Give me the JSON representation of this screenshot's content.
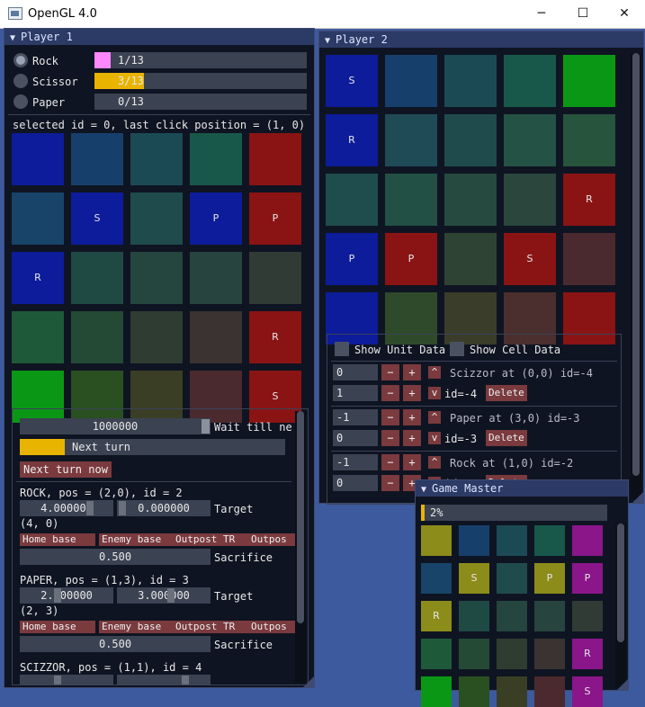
{
  "window": {
    "title": "OpenGL 4.0",
    "minimize": "─",
    "maximize": "☐",
    "close": "✕"
  },
  "player1": {
    "title": "Player 1",
    "counters": [
      {
        "label": "Rock",
        "text": "1/13",
        "fill": 0.077,
        "color": "#ff88ff",
        "selected": true
      },
      {
        "label": "Scissor",
        "text": "3/13",
        "fill": 0.231,
        "color": "#e8b400",
        "selected": false
      },
      {
        "label": "Paper",
        "text": "0/13",
        "fill": 0.0,
        "color": "#e8b400",
        "selected": false
      }
    ],
    "info": "selected id = 0, last click position = (1, 0)",
    "grid": [
      [
        {
          "c": "#0d1c9a",
          "t": ""
        },
        {
          "c": "#173f6b",
          "t": ""
        },
        {
          "c": "#1b4a55",
          "t": ""
        },
        {
          "c": "#18584a",
          "t": ""
        },
        {
          "c": "#8a1414",
          "t": ""
        }
      ],
      [
        {
          "c": "#174468",
          "t": ""
        },
        {
          "c": "#0d1c9a",
          "t": "S"
        },
        {
          "c": "#1f4b4c",
          "t": ""
        },
        {
          "c": "#0d1c9a",
          "t": "P"
        },
        {
          "c": "#8a1414",
          "t": "P"
        }
      ],
      [
        {
          "c": "#0d1c9a",
          "t": "R"
        },
        {
          "c": "#1f4a44",
          "t": ""
        },
        {
          "c": "#25453f",
          "t": ""
        },
        {
          "c": "#27443f",
          "t": ""
        },
        {
          "c": "#2f3b34",
          "t": ""
        }
      ],
      [
        {
          "c": "#1e5a39",
          "t": ""
        },
        {
          "c": "#244a35",
          "t": ""
        },
        {
          "c": "#2f3c31",
          "t": ""
        },
        {
          "c": "#3a3331",
          "t": ""
        },
        {
          "c": "#8a1414",
          "t": "R"
        }
      ],
      [
        {
          "c": "#0b9716",
          "t": ""
        },
        {
          "c": "#2a5022",
          "t": ""
        },
        {
          "c": "#3a3e25",
          "t": ""
        },
        {
          "c": "#4a2a2e",
          "t": ""
        },
        {
          "c": "#8a1414",
          "t": "S"
        }
      ]
    ],
    "sub": {
      "slider_value": "1000000",
      "wait_label": "Wait till ne",
      "next_turn_label": "Next turn",
      "next_turn_progress": 0.17,
      "next_turn_now": "Next turn now",
      "units": [
        {
          "header": "ROCK, pos = (2,0), id = 2",
          "v1": "4.000000",
          "v2": "0.000000",
          "target_label": "Target",
          "coord": "(4, 0)",
          "sacrifice": "0.500",
          "sacrifice_label": "Sacrifice"
        },
        {
          "header": "PAPER, pos = (1,3), id = 3",
          "v1": "2.000000",
          "v2": "3.000000",
          "target_label": "Target",
          "coord": "(2, 3)",
          "sacrifice": "0.500",
          "sacrifice_label": "Sacrifice"
        }
      ],
      "buttons": [
        "Home base",
        "Enemy base",
        "Outpost TR",
        "Outpos"
      ],
      "last_header": "SCIZZOR, pos = (1,1), id = 4"
    }
  },
  "player2": {
    "title": "Player 2",
    "grid": [
      [
        {
          "c": "#0d1c9a",
          "t": "S"
        },
        {
          "c": "#173f6b",
          "t": ""
        },
        {
          "c": "#1b4a55",
          "t": ""
        },
        {
          "c": "#18584a",
          "t": ""
        },
        {
          "c": "#0b9716",
          "t": ""
        }
      ],
      [
        {
          "c": "#0d1c9a",
          "t": "R"
        },
        {
          "c": "#1f4b57",
          "t": ""
        },
        {
          "c": "#1f4b4c",
          "t": ""
        },
        {
          "c": "#245244",
          "t": ""
        },
        {
          "c": "#27543c",
          "t": ""
        }
      ],
      [
        {
          "c": "#1f4d4e",
          "t": ""
        },
        {
          "c": "#225045",
          "t": ""
        },
        {
          "c": "#264a40",
          "t": ""
        },
        {
          "c": "#2b463d",
          "t": ""
        },
        {
          "c": "#8a1414",
          "t": "R"
        }
      ],
      [
        {
          "c": "#0d1c9a",
          "t": "P"
        },
        {
          "c": "#8a1414",
          "t": "P"
        },
        {
          "c": "#2f4334",
          "t": ""
        },
        {
          "c": "#8a1414",
          "t": "S"
        },
        {
          "c": "#4a2a2e",
          "t": ""
        }
      ],
      [
        {
          "c": "#0d1c9a",
          "t": ""
        },
        {
          "c": "#2f4a2a",
          "t": ""
        },
        {
          "c": "#3a3d29",
          "t": ""
        },
        {
          "c": "#4a2f2e",
          "t": ""
        },
        {
          "c": "#8a1414",
          "t": ""
        }
      ]
    ],
    "show_unit_data": "Show Unit Data",
    "show_cell_data": "Show Cell Data",
    "units": [
      {
        "a": "0",
        "b": "1",
        "desc": "Scizzor at (0,0) id=-4",
        "id": "id=-4"
      },
      {
        "a": "-1",
        "b": "0",
        "desc": "Paper at (3,0) id=-3",
        "id": "id=-3"
      },
      {
        "a": "-1",
        "b": "0",
        "desc": "Rock at (1,0) id=-2",
        "id": "id=-2"
      }
    ],
    "minus": "−",
    "plus": "+",
    "up": "^",
    "down": "v",
    "delete": "Delete"
  },
  "gm": {
    "title": "Game Master",
    "progress": "2%",
    "progress_value": 0.02,
    "grid": [
      [
        {
          "c": "#8c8c1a",
          "t": ""
        },
        {
          "c": "#173f6b",
          "t": ""
        },
        {
          "c": "#1b4a55",
          "t": ""
        },
        {
          "c": "#18584a",
          "t": ""
        },
        {
          "c": "#8a168a",
          "t": ""
        }
      ],
      [
        {
          "c": "#174468",
          "t": ""
        },
        {
          "c": "#8c8c1a",
          "t": "S"
        },
        {
          "c": "#1f4b4c",
          "t": ""
        },
        {
          "c": "#8c8c1a",
          "t": "P"
        },
        {
          "c": "#8a168a",
          "t": "P"
        }
      ],
      [
        {
          "c": "#8c8c1a",
          "t": "R"
        },
        {
          "c": "#1f4a44",
          "t": ""
        },
        {
          "c": "#25453f",
          "t": ""
        },
        {
          "c": "#27443f",
          "t": ""
        },
        {
          "c": "#2f3b34",
          "t": ""
        }
      ],
      [
        {
          "c": "#1e5a39",
          "t": ""
        },
        {
          "c": "#244a35",
          "t": ""
        },
        {
          "c": "#2f3c31",
          "t": ""
        },
        {
          "c": "#3a3331",
          "t": ""
        },
        {
          "c": "#8a168a",
          "t": "R"
        }
      ],
      [
        {
          "c": "#0b9716",
          "t": ""
        },
        {
          "c": "#2a5022",
          "t": ""
        },
        {
          "c": "#3a3e25",
          "t": ""
        },
        {
          "c": "#4a2a2e",
          "t": ""
        },
        {
          "c": "#8a168a",
          "t": "S"
        }
      ]
    ]
  },
  "colors": {
    "accent": "#e8b400",
    "button_red": "#7a3a3e",
    "panel_bg": "#0f1422",
    "header": "#2c3a66"
  }
}
